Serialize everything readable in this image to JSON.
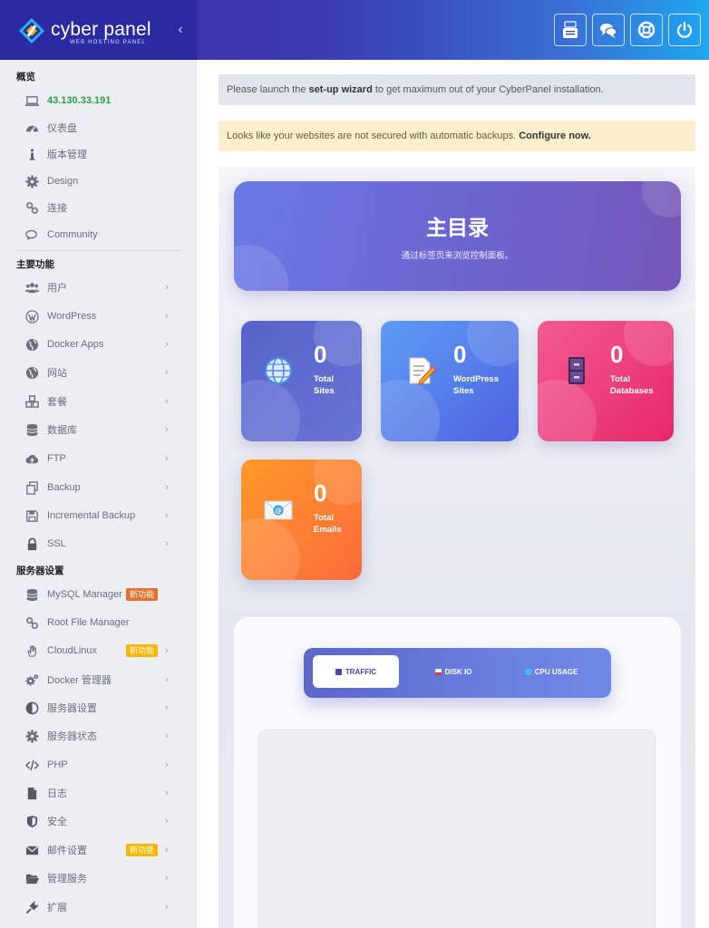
{
  "header": {
    "logo_text": "cyber panel",
    "logo_subtitle": "WEB HOSTING PANEL",
    "collapse_glyph": "‹",
    "icons": [
      "youtube-icon",
      "chat-icon",
      "support-icon",
      "power-icon"
    ]
  },
  "sidebar": {
    "section_overview": "概览",
    "section_main": "主要功能",
    "section_server": "服务器设置",
    "overview_items": [
      {
        "label": "43.130.33.191",
        "icon": "laptop-icon"
      },
      {
        "label": "仪表盘",
        "icon": "dashboard-icon"
      },
      {
        "label": "版本管理",
        "icon": "info-icon"
      },
      {
        "label": "Design",
        "icon": "gear-icon"
      },
      {
        "label": "连接",
        "icon": "link-icon"
      },
      {
        "label": "Community",
        "icon": "comments-icon"
      }
    ],
    "main_items": [
      {
        "label": "用户",
        "icon": "users-icon"
      },
      {
        "label": "WordPress",
        "icon": "wordpress-icon"
      },
      {
        "label": "Docker Apps",
        "icon": "globe-icon"
      },
      {
        "label": "网站",
        "icon": "globe-icon"
      },
      {
        "label": "套餐",
        "icon": "cubes-icon"
      },
      {
        "label": "数据库",
        "icon": "database-icon"
      },
      {
        "label": "FTP",
        "icon": "cloud-upload-icon"
      },
      {
        "label": "Backup",
        "icon": "copy-icon"
      },
      {
        "label": "Incremental Backup",
        "icon": "save-icon"
      },
      {
        "label": "SSL",
        "icon": "lock-icon"
      }
    ],
    "server_items": [
      {
        "label": "MySQL Manager",
        "icon": "database-icon",
        "badge": "新功能"
      },
      {
        "label": "Root File Manager",
        "icon": "link-icon"
      },
      {
        "label": "CloudLinux",
        "icon": "hand-icon",
        "badge": "新功能"
      },
      {
        "label": "Docker 管理器",
        "icon": "cogs-icon"
      },
      {
        "label": "服务器设置",
        "icon": "adjust-icon"
      },
      {
        "label": "服务器状态",
        "icon": "gear-icon"
      },
      {
        "label": "PHP",
        "icon": "code-icon"
      },
      {
        "label": "日志",
        "icon": "file-icon"
      },
      {
        "label": "安全",
        "icon": "shield-icon"
      },
      {
        "label": "邮件设置",
        "icon": "envelope-icon",
        "badge": "新功能"
      },
      {
        "label": "管理服务",
        "icon": "folder-open-icon"
      },
      {
        "label": "扩展",
        "icon": "plug-icon"
      }
    ]
  },
  "alerts": {
    "setup_prefix": "Please launch the ",
    "setup_link": "set-up wizard",
    "setup_suffix": " to get maximum out of your CyberPanel installation.",
    "backup_text": "Looks like your websites are not secured with automatic backups. ",
    "backup_link": "Configure now."
  },
  "hero": {
    "title": "主目录",
    "subtitle": "通过标签页来浏览控制面板。"
  },
  "stats": [
    {
      "value": "0",
      "line1": "Total",
      "line2": "Sites",
      "icon": "globe-icon"
    },
    {
      "value": "0",
      "line1": "WordPress",
      "line2": "Sites",
      "icon": "document-edit-icon"
    },
    {
      "value": "0",
      "line1": "Total",
      "line2": "Databases",
      "icon": "file-cabinet-icon"
    },
    {
      "value": "0",
      "line1": "Total",
      "line2": "Emails",
      "icon": "email-envelope-icon"
    }
  ],
  "tabs": [
    {
      "label": "TRAFFIC",
      "active": true
    },
    {
      "label": "DISK IO",
      "active": false
    },
    {
      "label": "CPU USAGE",
      "active": false
    }
  ],
  "colors": {
    "brand_dark": "#2b2aa2",
    "ip_green": "#2e9d3d",
    "badge_orange": "#e3702c",
    "badge_yellow": "#f6b800",
    "card_sites": "#5b6bd0",
    "card_wordpress": "#5b7de8",
    "card_databases": "#ec3e7a",
    "card_emails": "#fd7e2a"
  }
}
